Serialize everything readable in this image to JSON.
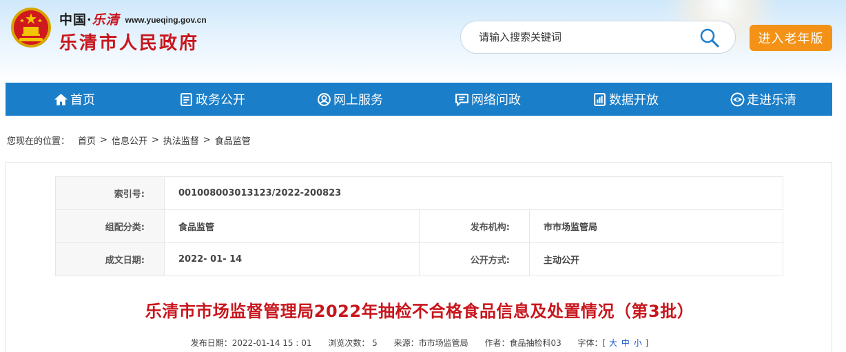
{
  "header": {
    "cn_prefix": "中国·",
    "cn_script": "乐清",
    "domain": "www.yueqing.gov.cn",
    "gov_name": "乐清市人民政府",
    "search_placeholder": "请输入搜索关键词",
    "elder_button": "进入老年版"
  },
  "nav": {
    "items": [
      {
        "label": "首页",
        "icon": "home-icon"
      },
      {
        "label": "政务公开",
        "icon": "document-icon"
      },
      {
        "label": "网上服务",
        "icon": "service-icon"
      },
      {
        "label": "网络问政",
        "icon": "chat-icon"
      },
      {
        "label": "数据开放",
        "icon": "data-icon"
      },
      {
        "label": "走进乐清",
        "icon": "eye-icon"
      }
    ]
  },
  "breadcrumb": {
    "prefix": "您现在的位置：",
    "items": [
      "首页",
      "信息公开",
      "执法监督",
      "食品监管"
    ],
    "separator": ">"
  },
  "meta": {
    "index_label": "索引号:",
    "index_value": "001008003013123/2022-200823",
    "category_label": "组配分类:",
    "category_value": "食品监管",
    "publisher_label": "发布机构:",
    "publisher_value": "市市场监管局",
    "date_label": "成文日期:",
    "date_value": "2022- 01- 14",
    "disclosure_label": "公开方式:",
    "disclosure_value": "主动公开"
  },
  "article": {
    "title": "乐清市市场监督管理局2022年抽检不合格食品信息及处置情况（第3批）",
    "publish_date": "发布日期：2022-01-14 15 : 01",
    "views": "浏览次数：  5",
    "source": "来源：市市场监管局",
    "author": "作者：食品抽检科03",
    "font_label": "字体：[",
    "font_large": "大",
    "font_medium": "中",
    "font_small": "小",
    "font_close": "]"
  },
  "colors": {
    "nav_blue": "#1b7ec9",
    "title_red": "#c8161d",
    "elder_orange": "#f39217"
  }
}
